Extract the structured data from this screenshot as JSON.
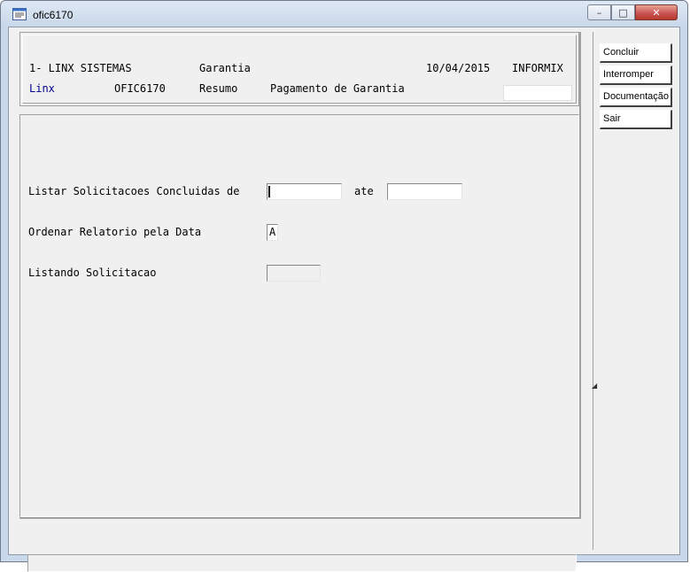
{
  "window": {
    "title": "ofic6170",
    "minimize": "–",
    "maximize": "□",
    "close": "✕"
  },
  "header": {
    "company": "1- LINX SISTEMAS",
    "module": "Garantia",
    "date": "10/04/2015",
    "db": "INFORMIX",
    "brand": "Linx",
    "program": "OFIC6170",
    "mode": "Resumo",
    "screen_title": "Pagamento de Garantia"
  },
  "form": {
    "listar_label": "Listar Solicitacoes Concluidas de",
    "from_value": "",
    "ate_label": "ate",
    "to_value": "",
    "ordenar_label": "Ordenar Relatorio pela Data",
    "ordenar_value": "A",
    "listando_label": "Listando Solicitacao",
    "listando_value": ""
  },
  "actions": {
    "concluir": "Concluir",
    "interromper": "Interromper",
    "documentacao": "Documentação",
    "sair": "Sair"
  },
  "icons": {
    "app": "terminal-window-icon"
  }
}
